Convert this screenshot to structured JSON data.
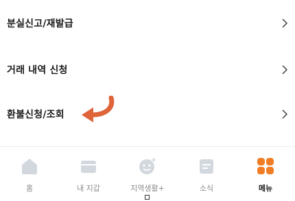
{
  "menu": {
    "items": [
      {
        "label": "분실신고/재발급"
      },
      {
        "label": "거래 내역 신청"
      },
      {
        "label": "환불신청/조회"
      }
    ]
  },
  "annotation": {
    "arrow_color": "#E0643A"
  },
  "tabbar": {
    "tabs": [
      {
        "label": "홈",
        "icon": "home-icon",
        "active": false
      },
      {
        "label": "내 지갑",
        "icon": "wallet-icon",
        "active": false
      },
      {
        "label": "지역생활+",
        "icon": "local-life-icon",
        "active": false
      },
      {
        "label": "소식",
        "icon": "news-icon",
        "active": false
      },
      {
        "label": "메뉴",
        "icon": "menu-grid-icon",
        "active": true
      }
    ],
    "inactive_icon_color": "#D3D8DE",
    "active_icon_color": "#F07D23"
  }
}
